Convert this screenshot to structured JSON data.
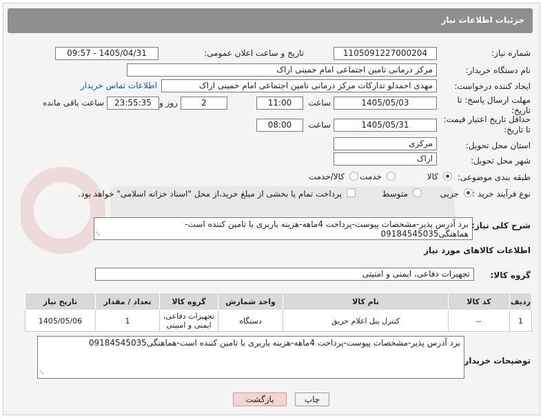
{
  "header": {
    "title": "جزئیات اطلاعات نیاز"
  },
  "form": {
    "need_number_label": "شماره نیاز:",
    "need_number": "1105091227000204",
    "announce_label": "تاریخ و ساعت اعلان عمومی:",
    "announce_value": "1405/04/31 - 09:57",
    "buyer_org_label": "نام دستگاه خریدار:",
    "buyer_org": "مرکز درمانی تامین اجتماعی امام خمینی اراک",
    "requester_label": "ایجاد کننده درخواست:",
    "requester": "مهدی احمدلو تدارکات مرکز درمانی تامین اجتماعی امام خمینی اراک",
    "contact_link": "اطلاعات تماس خریدار",
    "deadline_label": "مهلت ارسال پاسخ: تا تاریخ:",
    "deadline_date": "1405/05/03",
    "time_label": "ساعت",
    "deadline_time": "11:00",
    "days_value": "2",
    "days_label": "روز و",
    "remaining_value": "23:55:35",
    "remaining_label": "ساعت باقی مانده",
    "min_price_label": "حداقل تاریخ اعتبار قیمت: تا تاریخ:",
    "min_price_date": "1405/05/31",
    "min_price_time": "08:00",
    "province_label": "استان محل تحویل:",
    "province": "مرکزی",
    "city_label": "شهر محل تحویل:",
    "city": "اراک",
    "category_label": "طبقه بندی موضوعی:",
    "category_options": [
      "کالا",
      "خدمت",
      "کالا/خدمت"
    ],
    "process_label": "نوع فرآیند خرید :",
    "process_options": [
      "جزیی",
      "متوسط"
    ],
    "payment_note": "پرداخت تمام یا بخشی از مبلغ خرید،از محل \"اسناد خزانه اسلامی\" خواهد بود.",
    "description_label": "شرح کلی نیاز:",
    "description": "برد آدرس پذیر-مشخصات پیوست-پرداخت 4ماهه-هزینه باربری با تامین کننده است-هماهنگی09184545035"
  },
  "goods": {
    "section_title": "اطلاعات کالاهای مورد نیاز",
    "group_label": "گروه کالا:",
    "group_value": "تجهیزات دفاعی، ایمنی و امنیتی",
    "columns": [
      "ردیف",
      "کد کالا",
      "نام کالا",
      "واحد شمارش",
      "گروه کالا",
      "تعداد / مقدار",
      "تاریخ نیاز"
    ],
    "rows": [
      {
        "row": "1",
        "code": "--",
        "name": "کنترل پنل اعلام حریق",
        "unit": "دستگاه",
        "group": "تجهیزات دفاعی، ایمنی و امنیتی",
        "qty": "1",
        "date": "1405/05/06"
      }
    ]
  },
  "buyer_notes": {
    "label": "توضیحات خریدار:",
    "text": "برد آدرس پذیر-مشخصات پیوست-پرداخت 4ماهه-هزینه باربری با تامین کننده است-هماهنگی09184545035"
  },
  "buttons": {
    "print": "چاپ",
    "back": "بازگشت"
  },
  "colors": {
    "header_bg": "#8f8f8f",
    "link": "#1a55b5",
    "back_btn": "#f7d4d4"
  }
}
